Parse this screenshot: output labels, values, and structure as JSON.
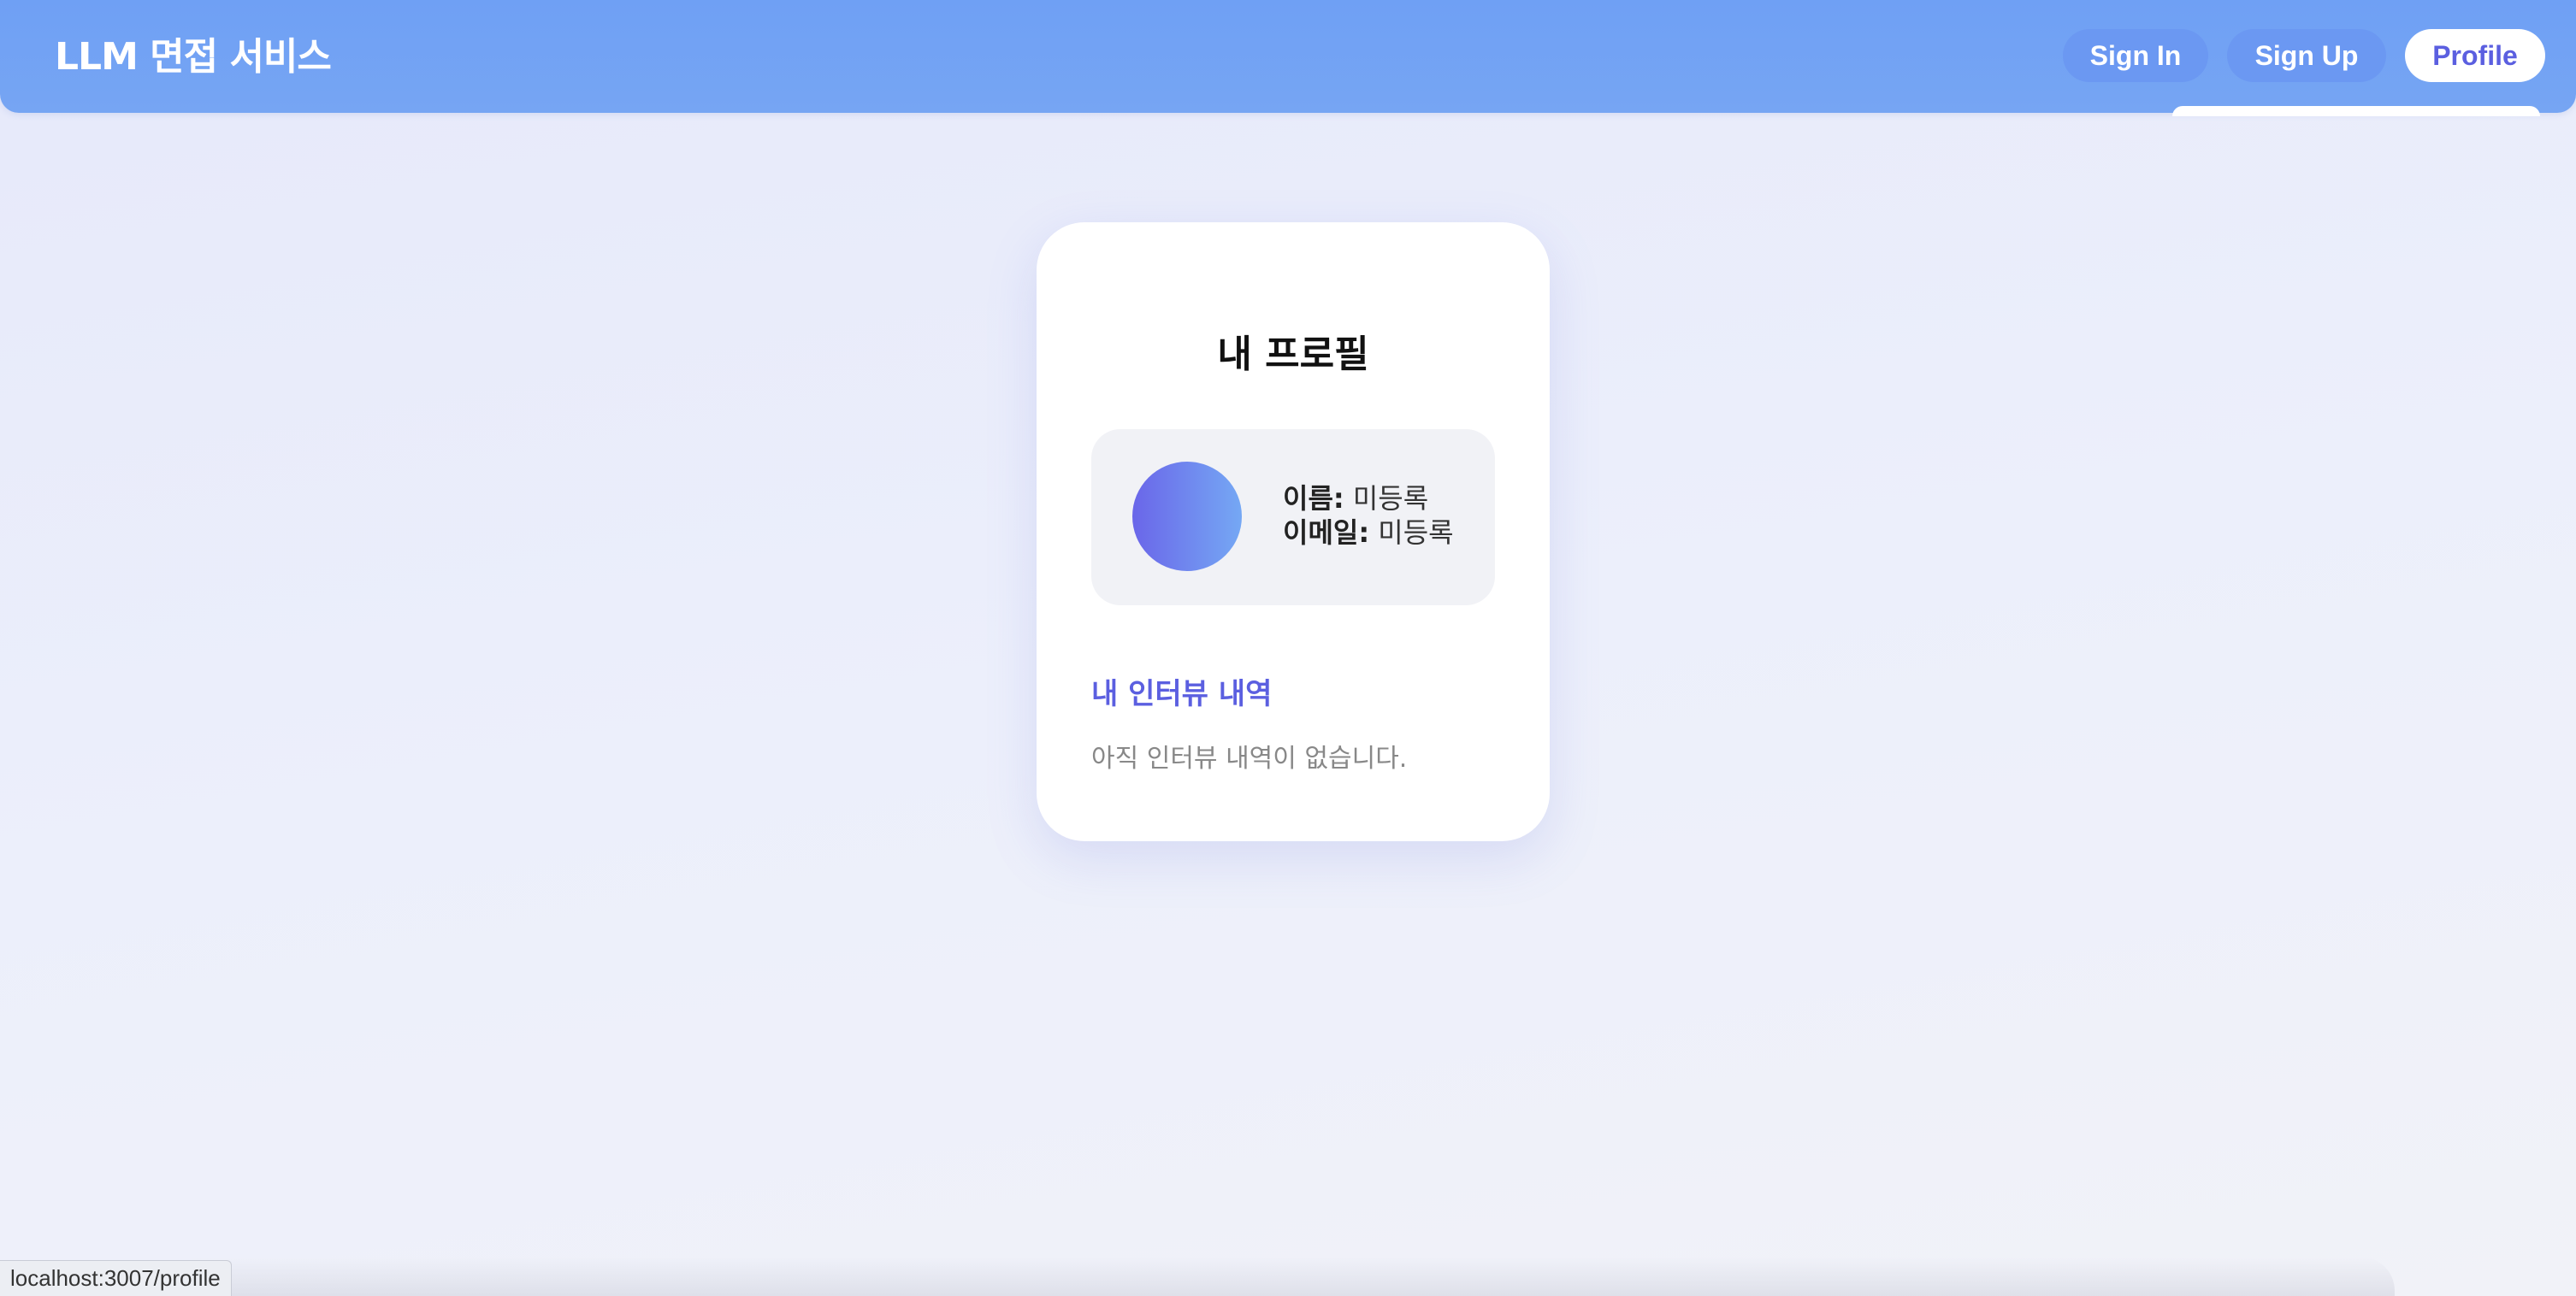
{
  "header": {
    "brand": "LLM 면접 서비스",
    "nav": {
      "sign_in": "Sign In",
      "sign_up": "Sign Up",
      "profile": "Profile"
    }
  },
  "card": {
    "title": "내 프로필",
    "name_label": "이름:",
    "name_value": "미등록",
    "email_label": "이메일:",
    "email_value": "미등록",
    "section_title": "내 인터뷰 내역",
    "empty_text": "아직 인터뷰 내역이 없습니다."
  },
  "status_bar": {
    "url": "localhost:3007/profile"
  },
  "colors": {
    "header_bg": "#6fa0f4",
    "accent": "#5b5fe0",
    "avatar_gradient_start": "#6a66e9",
    "avatar_gradient_end": "#75a8f4"
  }
}
